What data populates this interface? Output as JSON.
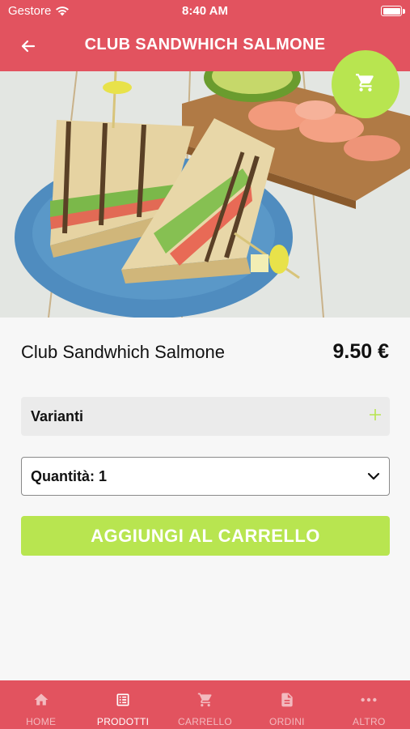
{
  "status_bar": {
    "carrier": "Gestore",
    "time": "8:40 AM"
  },
  "header": {
    "title": "CLUB SANDWHICH SALMONE"
  },
  "product": {
    "name": "Club Sandwhich Salmone",
    "price": "9.50 €"
  },
  "variants": {
    "label": "Varianti",
    "icon": "plus-icon"
  },
  "quantity": {
    "label": "Quantità: 1",
    "icon": "chevron-down-icon"
  },
  "add_to_cart": {
    "label": "AGGIUNGI AL CARRELLO"
  },
  "tabbar": {
    "items": [
      {
        "label": "HOME",
        "icon": "home-icon",
        "active": false
      },
      {
        "label": "PRODOTTI",
        "icon": "list-icon",
        "active": true
      },
      {
        "label": "CARRELLO",
        "icon": "cart-icon",
        "active": false
      },
      {
        "label": "ORDINI",
        "icon": "document-icon",
        "active": false
      },
      {
        "label": "ALTRO",
        "icon": "more-icon",
        "active": false
      }
    ]
  },
  "colors": {
    "primary": "#e2535f",
    "accent": "#b8e550"
  }
}
